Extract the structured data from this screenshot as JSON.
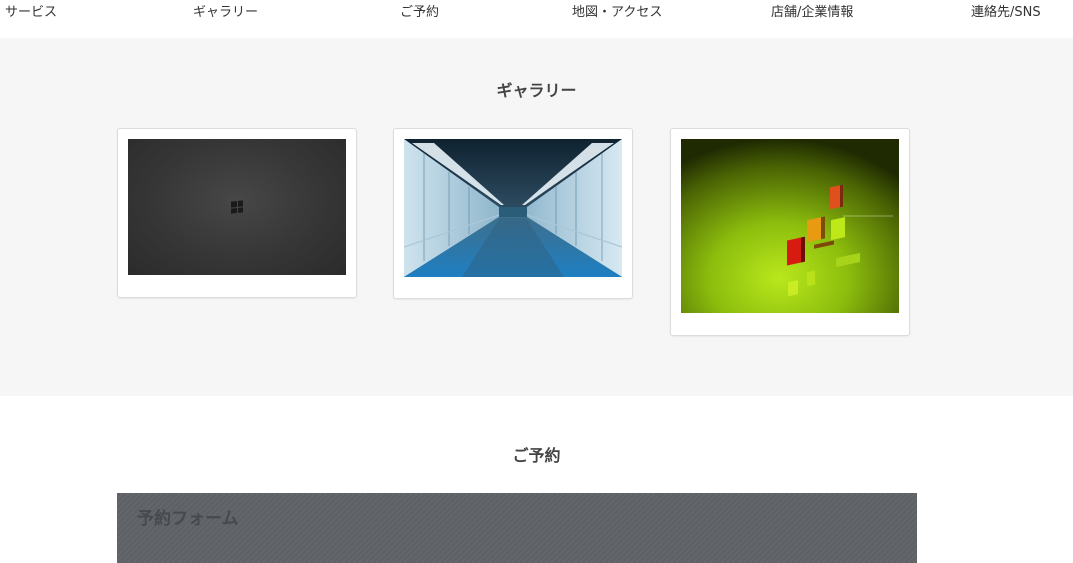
{
  "nav": {
    "items": [
      {
        "label": "サービス"
      },
      {
        "label": "ギャラリー"
      },
      {
        "label": "ご予約"
      },
      {
        "label": "地図・アクセス"
      },
      {
        "label": "店舗/企業情報"
      },
      {
        "label": "連絡先/SNS"
      }
    ]
  },
  "gallery": {
    "title": "ギャラリー",
    "images": [
      {
        "icon": "windows-dark-wallpaper"
      },
      {
        "icon": "airport-corridor-photo"
      },
      {
        "icon": "green-3d-blocks-wallpaper"
      }
    ]
  },
  "reservation": {
    "title": "ご予約",
    "form_title": "予約フォーム"
  },
  "colors": {
    "gallery_bg": "#f6f6f6",
    "form_bg": "#5e6166",
    "text": "#333333"
  }
}
